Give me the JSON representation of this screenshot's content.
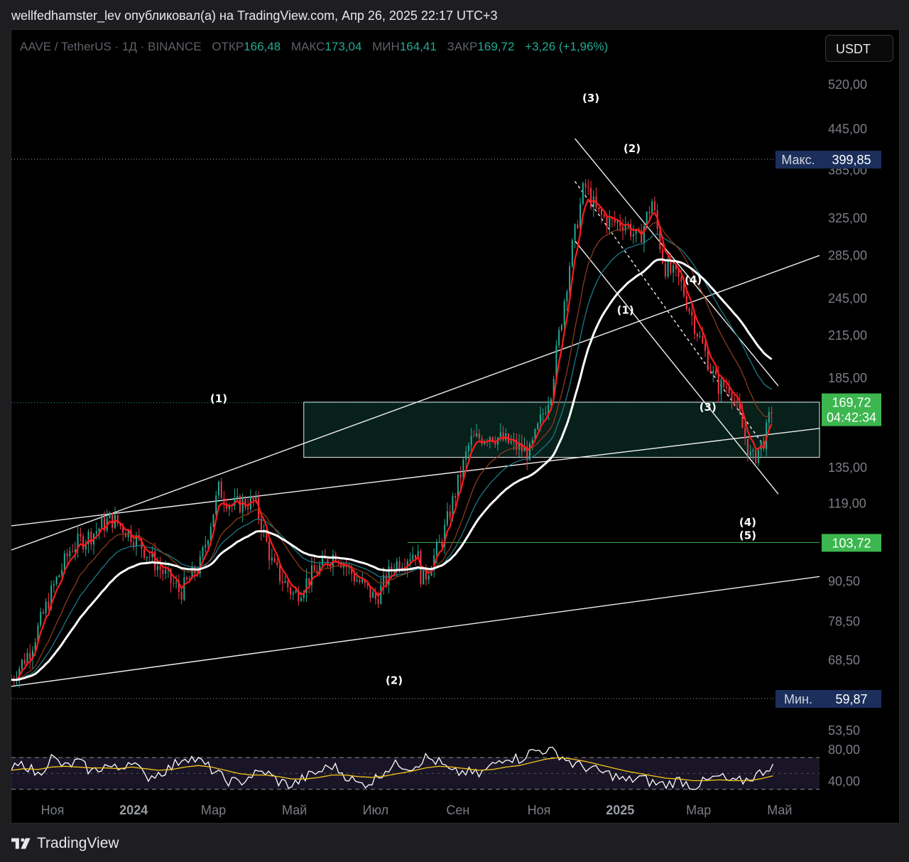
{
  "header": "wellfedhamster_lev опубликовал(а) на TradingView.com, Апр 26, 2025 22:17 UTC+3",
  "legend": {
    "symbol": "AAVE / TetherUS · 1Д · BINANCE",
    "open_label": "ОТКР",
    "open": "166,48",
    "high_label": "МАКС",
    "high": "173,04",
    "low_label": "МИН",
    "low": "164,41",
    "close_label": "ЗАКР",
    "close": "169,72",
    "change": "+3,26 (+1,96%)"
  },
  "currency_button": "USDT",
  "footer_brand": "TradingView",
  "colors": {
    "up": "#22ab94",
    "down": "#f23645",
    "ema_fast": "#ff1a1a",
    "ma_slow": "#ffffff",
    "zone": "#0c3a30",
    "rsi": "#ffffff",
    "rsi_ma": "#f5c518",
    "badge_dark": "#1c2f5c",
    "badge_green": "#3cb64f"
  },
  "chart_data": [
    {
      "type": "line",
      "title": "AAVE / TetherUS · 1Д · BINANCE",
      "scale": "log",
      "ylim": [
        50,
        600
      ],
      "y_ticks": [
        "520,00",
        "445,00",
        "385,00",
        "325,00",
        "285,00",
        "245,00",
        "215,00",
        "185,00",
        "135,00",
        "119,00",
        "90,50",
        "78,50",
        "68,50",
        "53,50"
      ],
      "x_ticks": [
        "Ноя",
        "2024",
        "Мар",
        "Май",
        "Июл",
        "Сен",
        "Ноя",
        "2025",
        "Мар",
        "Май"
      ],
      "x_range": [
        "2023-10-01",
        "2025-05-31"
      ],
      "series": [
        {
          "values_by_date": [
            [
              "2023-10-01",
              64
            ],
            [
              "2023-10-15",
              71
            ],
            [
              "2023-11-01",
              88
            ],
            [
              "2023-11-15",
              102
            ],
            [
              "2023-12-01",
              107
            ],
            [
              "2023-12-15",
              113
            ],
            [
              "2024-01-01",
              106
            ],
            [
              "2024-01-20",
              95
            ],
            [
              "2024-02-05",
              87
            ],
            [
              "2024-02-20",
              96
            ],
            [
              "2024-03-05",
              125
            ],
            [
              "2024-03-15",
              118
            ],
            [
              "2024-04-01",
              120
            ],
            [
              "2024-04-15",
              95
            ],
            [
              "2024-05-01",
              86
            ],
            [
              "2024-05-15",
              93
            ],
            [
              "2024-06-01",
              100
            ],
            [
              "2024-06-15",
              92
            ],
            [
              "2024-07-01",
              85
            ],
            [
              "2024-07-15",
              96
            ],
            [
              "2024-08-01",
              101
            ],
            [
              "2024-08-05",
              90
            ],
            [
              "2024-08-20",
              105
            ],
            [
              "2024-09-10",
              148
            ],
            [
              "2024-09-25",
              152
            ],
            [
              "2024-10-10",
              147
            ],
            [
              "2024-10-25",
              142
            ],
            [
              "2024-11-10",
              178
            ],
            [
              "2024-11-25",
              286
            ],
            [
              "2024-12-05",
              366
            ],
            [
              "2024-12-15",
              330
            ],
            [
              "2024-12-25",
              320
            ],
            [
              "2025-01-05",
              320
            ],
            [
              "2025-01-15",
              300
            ],
            [
              "2025-01-25",
              345
            ],
            [
              "2025-02-03",
              275
            ],
            [
              "2025-02-15",
              260
            ],
            [
              "2025-03-01",
              215
            ],
            [
              "2025-03-15",
              180
            ],
            [
              "2025-03-25",
              180
            ],
            [
              "2025-04-05",
              150
            ],
            [
              "2025-04-10",
              138
            ],
            [
              "2025-04-20",
              150
            ],
            [
              "2025-04-26",
              169.72
            ]
          ]
        }
      ],
      "annotations": {
        "high_label": "Макс.",
        "high_value": "399,85",
        "low_label": "Мин.",
        "low_value": "59,87",
        "last_price": "169,72",
        "countdown": "04:42:34",
        "support_level": "103,72",
        "zone_range": [
          140,
          170
        ],
        "wave_labels": [
          {
            "label": "(1)",
            "date": "2024-03-05",
            "price": 170
          },
          {
            "label": "(2)",
            "date": "2024-07-15",
            "price": 63
          },
          {
            "label": "(3)",
            "date": "2024-12-10",
            "price": 490
          },
          {
            "label": "(2)",
            "date": "2025-01-10",
            "price": 410
          },
          {
            "label": "(1)",
            "date": "2025-01-05",
            "price": 232
          },
          {
            "label": "(4)",
            "date": "2025-02-25",
            "price": 258
          },
          {
            "label": "(3)",
            "date": "2025-03-08",
            "price": 165
          },
          {
            "label": "(4)",
            "date": "2025-04-07",
            "price": 110
          },
          {
            "label": "(5)",
            "date": "2025-04-07",
            "price": 105
          }
        ]
      }
    },
    {
      "type": "line",
      "title": "RSI",
      "ylim": [
        20,
        95
      ],
      "y_ticks": [
        "80,00",
        "40,00"
      ],
      "bands": [
        70,
        30
      ],
      "series": [
        {
          "values": [
            55,
            62,
            48,
            70,
            58,
            65,
            52,
            60,
            55,
            68,
            45,
            50,
            58,
            72,
            66,
            55,
            42,
            38,
            48,
            52,
            40,
            35,
            45,
            52,
            60,
            48,
            36,
            40,
            55,
            62,
            58,
            70,
            64,
            50,
            52,
            48,
            60,
            72,
            68,
            78,
            80,
            74,
            62,
            58,
            52,
            48,
            40,
            45,
            38,
            36,
            42,
            34,
            40,
            46,
            38,
            42,
            50,
            62
          ]
        },
        {
          "values": [
            54,
            56,
            55,
            58,
            59,
            58,
            57,
            57,
            56,
            58,
            56,
            54,
            55,
            58,
            60,
            58,
            54,
            50,
            48,
            48,
            46,
            43,
            43,
            45,
            48,
            48,
            46,
            45,
            47,
            50,
            53,
            57,
            59,
            58,
            56,
            54,
            55,
            58,
            60,
            64,
            68,
            70,
            68,
            65,
            61,
            57,
            53,
            50,
            47,
            44,
            43,
            41,
            41,
            42,
            41,
            41,
            43,
            47
          ]
        }
      ]
    }
  ]
}
